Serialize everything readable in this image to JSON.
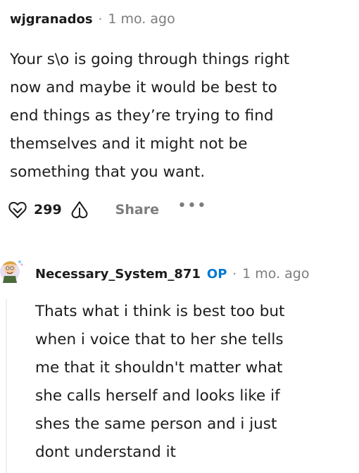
{
  "comments": [
    {
      "username": "wjgranados",
      "separator": "·",
      "time": "1 mo. ago",
      "body_lines": [
        "Your s\\o is going through things right",
        "now and maybe it would be best to",
        "end things as they’re trying to find",
        "themselves and it might not be",
        "something that you want."
      ],
      "score": "299",
      "share_label": "Share",
      "more_label": "•••"
    },
    {
      "username": "Necessary_System_871",
      "op_label": "OP",
      "separator": "·",
      "time": "1 mo. ago",
      "body_lines": [
        "Thats what i think is best too but",
        "when i voice that to her she tells",
        "me that it shouldn't matter what",
        "she calls herself and looks like if",
        "shes the same person and i just",
        "dont understand it"
      ]
    }
  ],
  "icons": {
    "upvote": "upvote-icon",
    "downvote": "downvote-icon",
    "avatar": "avatar"
  },
  "colors": {
    "text": "#1c1c1c",
    "muted": "#7c7c7c",
    "op": "#0079d3",
    "thread_line": "#edeff1"
  }
}
